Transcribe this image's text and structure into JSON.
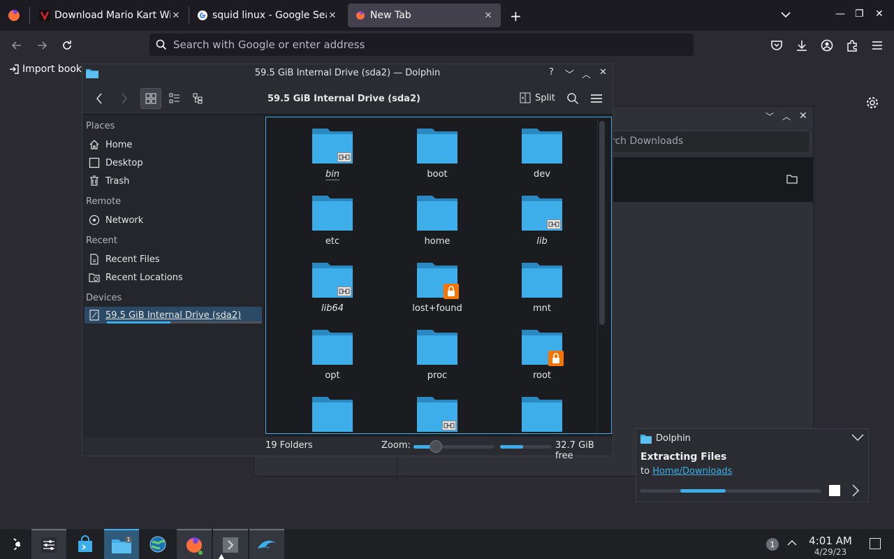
{
  "browser": {
    "tabs": [
      {
        "title": "Download Mario Kart Wii",
        "active": false
      },
      {
        "title": "squid linux - Google Search",
        "active": false
      },
      {
        "title": "New Tab",
        "active": true
      }
    ],
    "url_placeholder": "Search with Google or enter address",
    "bookmark_import": "Import bookm"
  },
  "downloads_bg": {
    "search_placeholder": "rch Downloads"
  },
  "dolphin": {
    "window_title": "59.5 GiB Internal Drive (sda2) — Dolphin",
    "breadcrumb": "59.5 GiB Internal Drive (sda2)",
    "split_label": "Split",
    "places": {
      "sections": [
        {
          "header": "Places",
          "items": [
            {
              "label": "Home",
              "icon": "home-icon"
            },
            {
              "label": "Desktop",
              "icon": "desktop-icon"
            },
            {
              "label": "Trash",
              "icon": "trash-icon"
            }
          ]
        },
        {
          "header": "Remote",
          "items": [
            {
              "label": "Network",
              "icon": "network-icon"
            }
          ]
        },
        {
          "header": "Recent",
          "items": [
            {
              "label": "Recent Files",
              "icon": "recent-files-icon"
            },
            {
              "label": "Recent Locations",
              "icon": "recent-locations-icon"
            }
          ]
        },
        {
          "header": "Devices",
          "items": [
            {
              "label": "59.5 GiB Internal Drive (sda2)",
              "icon": "drive-icon",
              "selected": true,
              "usage_fraction": 0.41
            }
          ]
        }
      ]
    },
    "folders": [
      {
        "name": "bin",
        "badge": "symlink"
      },
      {
        "name": "boot",
        "badge": ""
      },
      {
        "name": "dev",
        "badge": ""
      },
      {
        "name": "etc",
        "badge": ""
      },
      {
        "name": "home",
        "badge": ""
      },
      {
        "name": "lib",
        "badge": "symlink"
      },
      {
        "name": "lib64",
        "badge": "symlink"
      },
      {
        "name": "lost+found",
        "badge": "locked"
      },
      {
        "name": "mnt",
        "badge": ""
      },
      {
        "name": "opt",
        "badge": ""
      },
      {
        "name": "proc",
        "badge": ""
      },
      {
        "name": "root",
        "badge": "locked"
      },
      {
        "name": "",
        "badge": ""
      },
      {
        "name": "",
        "badge": "symlink"
      },
      {
        "name": "",
        "badge": ""
      }
    ],
    "status": {
      "count": "19 Folders",
      "zoom_label": "Zoom:",
      "zoom_fraction": 0.28,
      "free_label": "32.7 GiB free",
      "used_fraction": 0.45
    }
  },
  "notification": {
    "app": "Dolphin",
    "heading": "Extracting Files",
    "to_prefix": "to",
    "to_link": "Home/Downloads"
  },
  "taskbar": {
    "badge_count": "1",
    "tray_count": "1",
    "time": "4:01 AM",
    "date": "4/29/23"
  },
  "colors": {
    "accent": "#3daee9",
    "folder": "#3daee9",
    "lock": "#f67400"
  }
}
